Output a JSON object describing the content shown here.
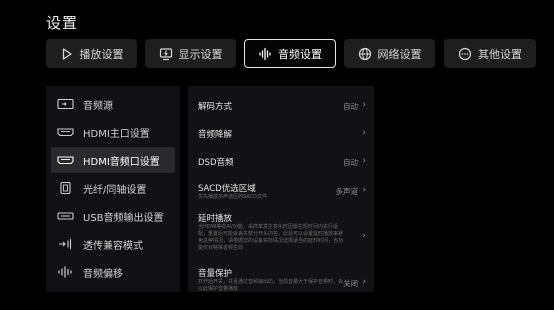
{
  "page": {
    "title": "设置"
  },
  "tabs": [
    {
      "label": "播放设置",
      "icon": "play-icon"
    },
    {
      "label": "显示设置",
      "icon": "display-icon"
    },
    {
      "label": "音频设置",
      "icon": "audio-wave-icon"
    },
    {
      "label": "网络设置",
      "icon": "globe-icon"
    },
    {
      "label": "其他设置",
      "icon": "more-icon"
    }
  ],
  "sidebar": {
    "items": [
      {
        "label": "音频源",
        "icon": "audio-source-icon"
      },
      {
        "label": "HDMI主口设置",
        "icon": "hdmi-icon"
      },
      {
        "label": "HDMI音频口设置",
        "icon": "hdmi-icon"
      },
      {
        "label": "光纤/同轴设置",
        "icon": "optical-icon"
      },
      {
        "label": "USB音频输出设置",
        "icon": "usb-icon"
      },
      {
        "label": "透传兼容模式",
        "icon": "passthrough-icon"
      },
      {
        "label": "音频偏移",
        "icon": "audio-wave-icon"
      }
    ]
  },
  "settings": {
    "rows": [
      {
        "label": "解码方式",
        "value": "自动",
        "desc": ""
      },
      {
        "label": "音频降解",
        "value": "",
        "desc": ""
      },
      {
        "label": "DSD音频",
        "value": "自动",
        "desc": ""
      },
      {
        "label": "SACD优选区域",
        "value": "多声道",
        "desc": "优先播放多声道区的SACD文件"
      },
      {
        "label": "延时播放",
        "value": "",
        "desc": "当HDMI等有AV功能，采样率发生变化时因需在短时间内进行适配，重置后可能会丢失部分开头内容，此处可以设置延时播放来避免这种情况，请根据您的设备实际情况选择适当的延时时间，当功能仅对特殊音频生效"
      },
      {
        "label": "音量保护",
        "value": "关闭",
        "desc": "打开后开关，并且通过音频输出的，当前音量大于保护音量时，会以此保护音量播放"
      }
    ]
  },
  "colors": {
    "background": "#000000",
    "panel": "#121214",
    "active_border": "#e6e6e6"
  }
}
